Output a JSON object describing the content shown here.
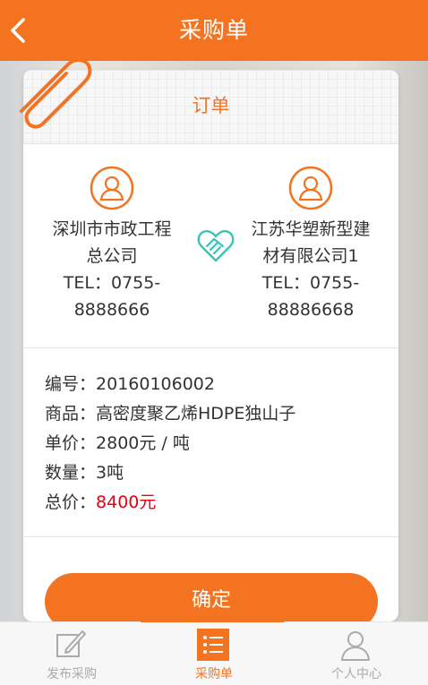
{
  "header": {
    "title": "采购单",
    "back_icon": "chevron-left-icon"
  },
  "card": {
    "title": "订单"
  },
  "parties": [
    {
      "name": "深圳市市政工程总公司",
      "tel": "TEL：0755-8888666",
      "icon": "user-icon"
    },
    {
      "name": "江苏华塑新型建材有限公司1",
      "tel": "TEL：0755-88886668",
      "icon": "user-icon"
    }
  ],
  "details": {
    "number_label": "编号：",
    "number": "20160106002",
    "product_label": "商品：",
    "product": "高密度聚乙烯HDPE独山子",
    "unit_price_label": "单价：",
    "unit_price": "2800元 / 吨",
    "quantity_label": "数量：",
    "quantity": "3吨",
    "total_label": "总价：",
    "total": "8400元"
  },
  "confirm_label": "确定",
  "tabs": [
    {
      "label": "发布采购",
      "icon": "edit-icon"
    },
    {
      "label": "采购单",
      "icon": "list-icon"
    },
    {
      "label": "个人中心",
      "icon": "user-icon"
    }
  ],
  "colors": {
    "accent": "#f47321",
    "price": "#e60012",
    "teal": "#3cc2b7"
  }
}
